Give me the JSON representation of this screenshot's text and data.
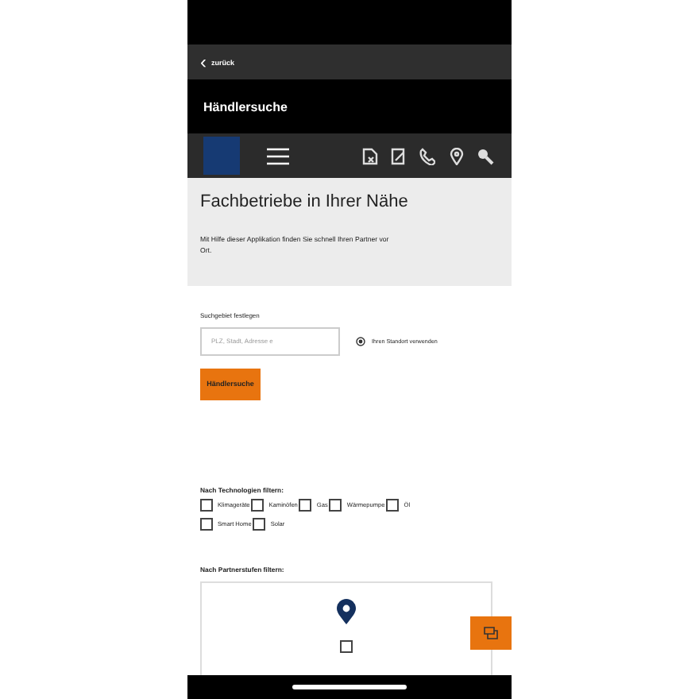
{
  "back": {
    "icon": "‹",
    "label": "zurück"
  },
  "title": "Händlersuche",
  "intro": {
    "heading": "Fachbetriebe in Ihrer Nähe",
    "text": "Mit Hilfe dieser Applikation finden Sie schnell Ihren Partner vor Ort."
  },
  "search": {
    "label": "Suchgebiet festlegen",
    "placeholder": "PLZ, Stadt, Adresse e",
    "location_link": "Ihren Standort verwenden",
    "button": "Händlersuche"
  },
  "technology_filter": {
    "label": "Nach Technologien filtern:",
    "options": [
      {
        "label": "Klimageräte",
        "checked": false
      },
      {
        "label": "Kaminöfen",
        "checked": false
      },
      {
        "label": "Gas",
        "checked": false
      },
      {
        "label": "Wärmepumpe",
        "checked": false
      },
      {
        "label": "Öl",
        "checked": false
      },
      {
        "label": "Smart Home",
        "checked": false
      },
      {
        "label": "Solar",
        "checked": false
      }
    ]
  },
  "partner_filter": {
    "label": "Nach Partnerstufen filtern:",
    "options": [
      {
        "checked": false
      }
    ]
  }
}
